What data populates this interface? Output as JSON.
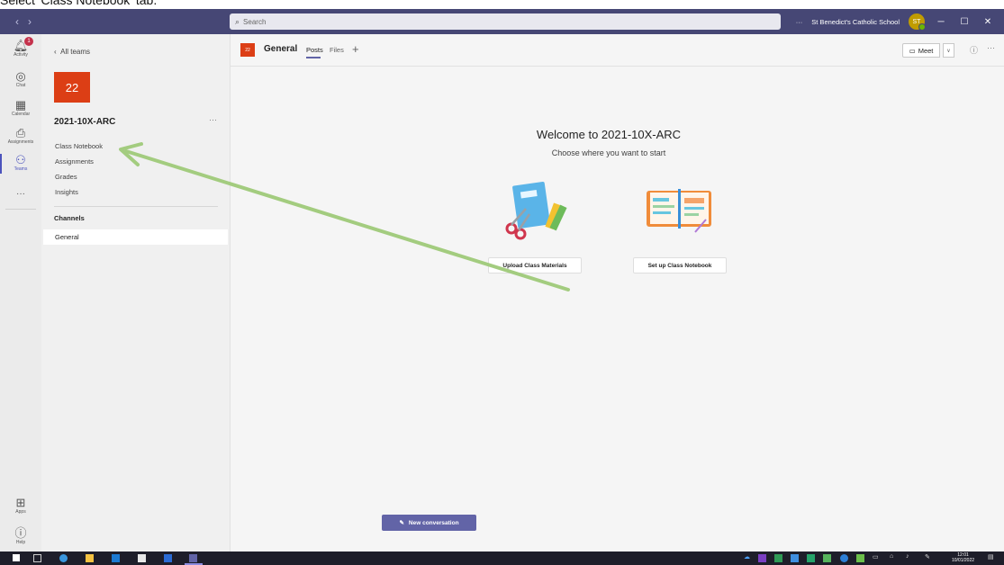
{
  "caption": "Select 'Class Notebook' tab.",
  "titlebar": {
    "search_placeholder": "Search",
    "org_name": "St Benedict's Catholic School",
    "avatar_initials": "ST",
    "more": "···"
  },
  "rail": {
    "items": [
      {
        "label": "Activity",
        "icon": "bell-icon",
        "badge": "1"
      },
      {
        "label": "Chat",
        "icon": "chat-icon"
      },
      {
        "label": "Calendar",
        "icon": "calendar-icon"
      },
      {
        "label": "Assignments",
        "icon": "assignments-icon"
      },
      {
        "label": "Teams",
        "icon": "teams-icon",
        "active": true
      }
    ],
    "more": "···",
    "apps_label": "Apps",
    "help_label": "Help"
  },
  "team_panel": {
    "back_label": "All teams",
    "tile_text": "22",
    "team_name": "2021-10X-ARC",
    "more": "···",
    "links": [
      "Class Notebook",
      "Assignments",
      "Grades",
      "Insights"
    ],
    "channels_heading": "Channels",
    "channels": [
      "General"
    ]
  },
  "header": {
    "tile_text": "22",
    "channel_name": "General",
    "tabs": [
      "Posts",
      "Files"
    ],
    "add_tab": "+",
    "meet_label": "Meet"
  },
  "welcome": {
    "title": "Welcome to 2021-10X-ARC",
    "subtitle": "Choose where you want to start",
    "options": [
      "Upload Class Materials",
      "Set up Class Notebook"
    ]
  },
  "new_conversation": "New conversation",
  "taskbar": {
    "time": "12:01",
    "date": "10/01/2022"
  },
  "colors": {
    "titlebar": "#464775",
    "accent": "#6264a7",
    "team_tile": "#dc3e15",
    "annotation_arrow": "#a3cc7f"
  }
}
